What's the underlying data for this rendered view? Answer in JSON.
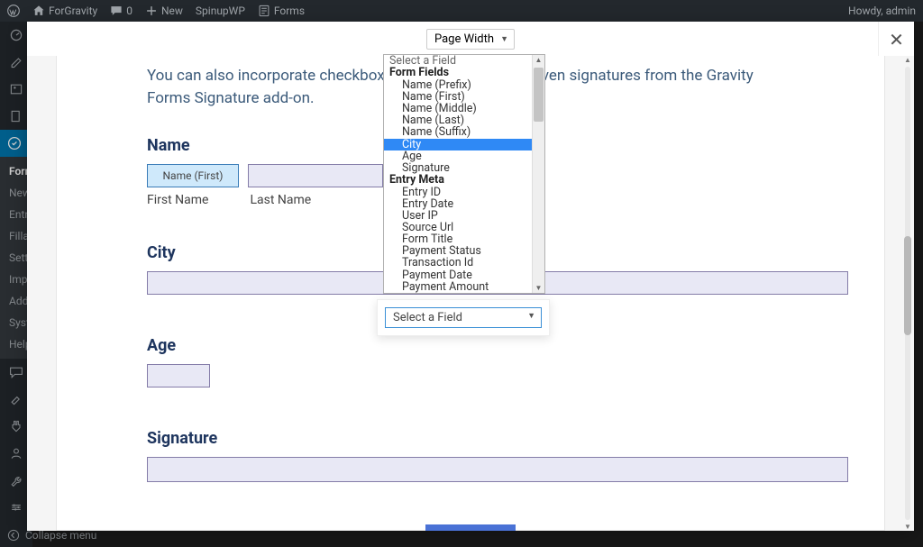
{
  "adminbar": {
    "site": "ForGravity",
    "comments": "0",
    "new": "New",
    "spinup": "SpinupWP",
    "forms": "Forms",
    "howdy": "Howdy, admin"
  },
  "sidebar": {
    "submenu": [
      "Forms",
      "New",
      "Entri",
      "Filla",
      "Sett",
      "Imp",
      "Add",
      "Syst",
      "Help"
    ],
    "collapse": "Collapse menu"
  },
  "modal": {
    "pageWidth": "Page Width",
    "close": "✕"
  },
  "doc": {
    "intro": "You can also incorporate checkboxes, radio buttons, and even signatures from the Gravity Forms Signature add-on.",
    "name": {
      "title": "Name",
      "tag": "Name (First)",
      "firstLabel": "First Name",
      "lastLabel": "Last Name"
    },
    "city": {
      "title": "City"
    },
    "age": {
      "title": "Age"
    },
    "signature": {
      "title": "Signature"
    }
  },
  "dropdown": {
    "placeholder": "Select a Field",
    "groups": [
      {
        "label": "Form Fields",
        "options": [
          "Name (Prefix)",
          "Name (First)",
          "Name (Middle)",
          "Name (Last)",
          "Name (Suffix)",
          "City",
          "Age",
          "Signature"
        ]
      },
      {
        "label": "Entry Meta",
        "options": [
          "Entry ID",
          "Entry Date",
          "User IP",
          "Source Url",
          "Form Title",
          "Payment Status",
          "Transaction Id",
          "Payment Date",
          "Payment Amount"
        ]
      }
    ],
    "highlighted": "City",
    "secondarySelect": "Select a Field"
  }
}
